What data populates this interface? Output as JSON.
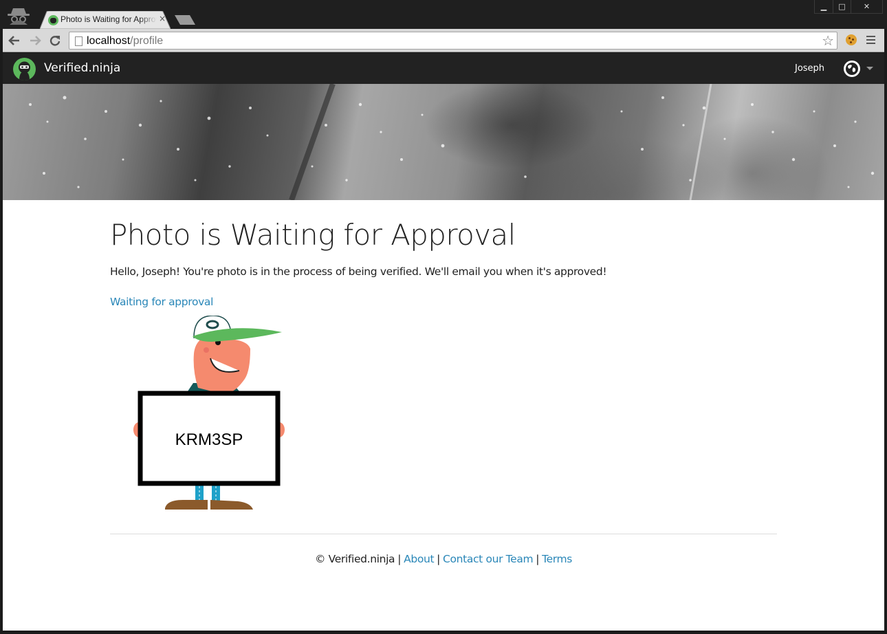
{
  "browser": {
    "tab_title": "Photo is Waiting for Approval",
    "tab_close": "×",
    "url_host": "localhost",
    "url_path": "/profile",
    "window_controls": {
      "minimize": "▁",
      "maximize": "□",
      "close": "✕"
    }
  },
  "navbar": {
    "brand": "Verified.ninja",
    "user_name": "Joseph"
  },
  "main": {
    "title": "Photo is Waiting for Approval",
    "message": "Hello, Joseph! You're photo is in the process of being verified. We'll email you when it's approved!",
    "status_link": "Waiting for approval",
    "sign_code": "KRM3SP"
  },
  "footer": {
    "copyright": "© Verified.ninja",
    "separator": "|",
    "links": [
      "About",
      "Contact our Team",
      "Terms"
    ]
  },
  "colors": {
    "brand_green": "#5cb85c",
    "link_blue": "#2a87b8",
    "navbar_bg": "#222222"
  },
  "icons": [
    "incognito-icon",
    "back-icon",
    "forward-icon",
    "reload-icon",
    "page-icon",
    "star-icon",
    "cookie-icon",
    "menu-icon",
    "globe-icon",
    "caret-down-icon"
  ]
}
